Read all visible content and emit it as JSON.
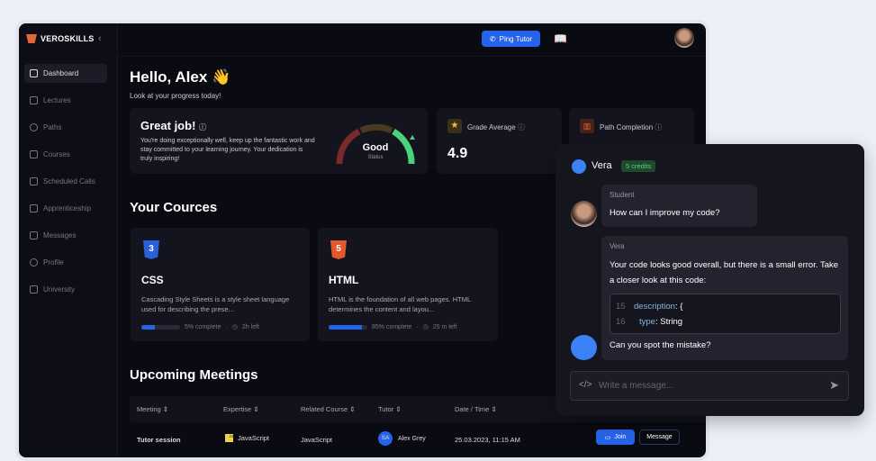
{
  "brand": "VEROSKILLS",
  "sidebar": {
    "items": [
      {
        "label": "Dashboard"
      },
      {
        "label": "Lectures"
      },
      {
        "label": "Paths"
      },
      {
        "label": "Courses"
      },
      {
        "label": "Scheduled Calls"
      },
      {
        "label": "Apprenticeship"
      },
      {
        "label": "Messages"
      },
      {
        "label": "Profile"
      },
      {
        "label": "University"
      }
    ]
  },
  "topbar": {
    "ping_label": "Ping Tutor"
  },
  "greeting": {
    "title": "Hello, Alex 👋",
    "subtitle": "Look at your progress today!"
  },
  "great_job": {
    "title": "Great job!",
    "text": "You're doing exceptionally well, keep up the fantastic work and stay committed to your learning journey. Your dedication is truly inspiring!",
    "gauge_value": "Good",
    "gauge_label": "Status"
  },
  "grade": {
    "label": "Grade Average",
    "value": "4.9"
  },
  "path": {
    "label": "Path Completion"
  },
  "courses": {
    "heading": "Your Cources",
    "items": [
      {
        "icon": "css3-icon",
        "title": "CSS",
        "desc": "Cascading Style Sheets is a style sheet language used for describing the prese...",
        "progress": 5,
        "progress_label": "5% complete",
        "time": "2h left"
      },
      {
        "icon": "html5-icon",
        "title": "HTML",
        "desc": "HTML is the foundation of all web pages. HTML determines the content and layou...",
        "progress": 85,
        "progress_label": "85% complete",
        "time": "25 m left"
      }
    ]
  },
  "meetings": {
    "heading": "Upcoming Meetings",
    "columns": [
      "Meeting",
      "Expertise",
      "Related Course",
      "Tutor",
      "Date / Time"
    ],
    "rows": [
      {
        "meeting": "Tutor session",
        "expertise": "JavaScript",
        "course": "JavaScript",
        "tutor_initials": "SA",
        "tutor": "Alex Grey",
        "datetime": "25.03.2023, 11:15 AM",
        "join": "Join",
        "message": "Message"
      }
    ]
  },
  "chat": {
    "name": "Vera",
    "credits": "5 credits",
    "student_label": "Student",
    "student_msg": "How can I improve my code?",
    "vera_label": "Vera",
    "vera_msg": "Your code looks good overall, but there is a small error. Take a closer look at this code:",
    "code": [
      {
        "line": "15",
        "key": "description",
        "rest": ": {"
      },
      {
        "line": "16",
        "key": "type",
        "rest": ": String"
      }
    ],
    "vera_followup": "Can you spot the mistake?",
    "placeholder": "Write a message..."
  }
}
